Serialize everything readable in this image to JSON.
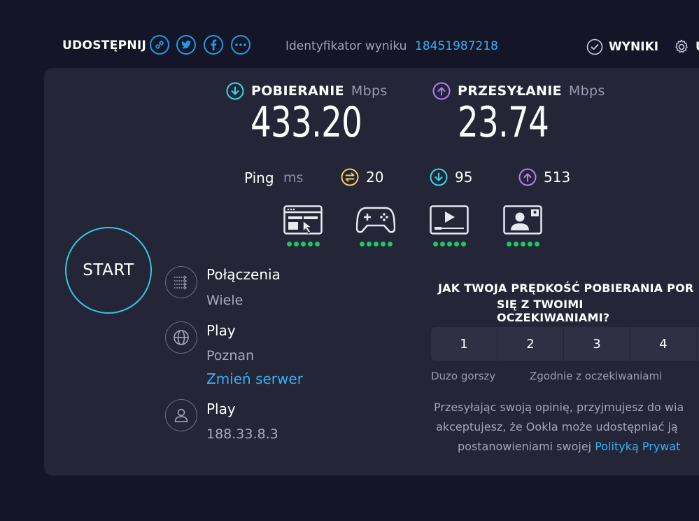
{
  "header": {
    "share_label": "UDOSTĘPNIJ",
    "share_icons": [
      "link-icon",
      "twitter-icon",
      "facebook-icon",
      "more-icon"
    ],
    "result_id_label": "Identyfikator wyniku",
    "result_id_value": "18451987218",
    "results_label": "WYNIKI",
    "settings_label": "U"
  },
  "download": {
    "label": "POBIERANIE",
    "unit": "Mbps",
    "value": "433.20",
    "icon": "download-arrow-icon",
    "color": "#37d7e6"
  },
  "upload": {
    "label": "PRZESYŁANIE",
    "unit": "Mbps",
    "value": "23.74",
    "icon": "upload-arrow-icon",
    "color": "#b87cf5"
  },
  "ping": {
    "label": "Ping",
    "unit": "ms",
    "idle": "20",
    "download": "95",
    "upload": "513",
    "idle_color": "#f3cf56"
  },
  "quality": [
    {
      "name": "browsing-icon",
      "score": 5
    },
    {
      "name": "gaming-icon",
      "score": 5
    },
    {
      "name": "streaming-icon",
      "score": 5
    },
    {
      "name": "video-call-icon",
      "score": 5
    }
  ],
  "start_label": "START",
  "connections": {
    "title": "Połączenia",
    "value": "Wiele"
  },
  "server": {
    "title": "Play",
    "location": "Poznan",
    "change_link": "Zmień serwer"
  },
  "provider": {
    "title": "Play",
    "ip": "188.33.8.3"
  },
  "survey": {
    "question_line1": "JAK TWOJA PRĘDKOŚĆ POBIERANIA POR",
    "question_line2": "SIĘ Z TWOIMI OCZEKIWANIAMI?",
    "options": [
      "1",
      "2",
      "3",
      "4"
    ],
    "label_low": "Duzo gorszy",
    "label_mid": "Zgodnie z oczekiwaniami",
    "disclaimer_line1": "Przesyłając swoją opinię, przyjmujesz do wia",
    "disclaimer_line2": "akceptujesz, że Ookla może udostępniać ją",
    "disclaimer_line3": "postanowieniami swojej",
    "disclaimer_link": "Polityką Prywat"
  },
  "colors": {
    "background": "#141526",
    "panel": "#242537",
    "accent_blue": "#1e9be8",
    "link_blue": "#3ab0f5",
    "good_green": "#1fc56b",
    "start_ring": "#33c8e0"
  }
}
